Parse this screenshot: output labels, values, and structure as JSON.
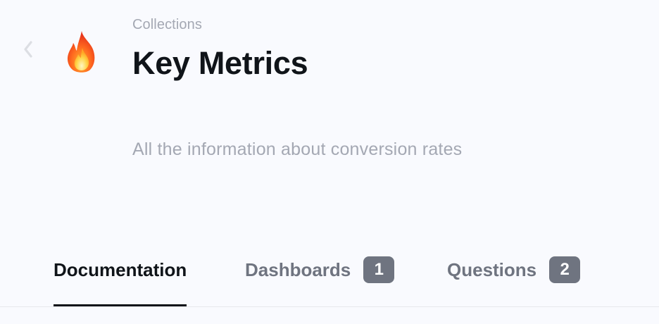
{
  "header": {
    "breadcrumb": "Collections",
    "title": "Key Metrics",
    "icon": "fire-icon"
  },
  "description": "All the information about conversion rates",
  "tabs": [
    {
      "label": "Documentation",
      "active": true
    },
    {
      "label": "Dashboards",
      "badge": "1",
      "active": false
    },
    {
      "label": "Questions",
      "badge": "2",
      "active": false
    }
  ],
  "colors": {
    "background": "#f9fafe",
    "title": "#101419",
    "muted_text": "#a4a8b3",
    "tab_inactive": "#6f7480",
    "badge_bg": "#6f7480",
    "badge_text": "#ffffff",
    "active_indicator": "#101419",
    "divider": "#e7e8ec"
  }
}
